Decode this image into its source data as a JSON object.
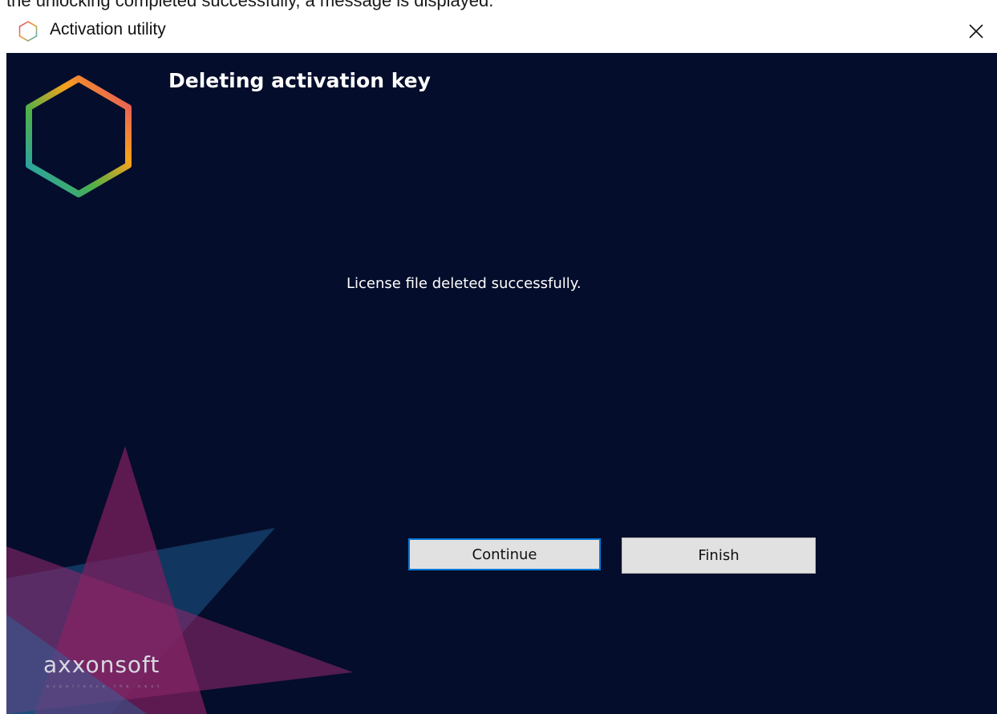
{
  "top_caption": "the unlocking completed successfully, a message is displayed.",
  "window": {
    "title": "Activation utility",
    "close_icon": "close-icon",
    "app_icon": "hexagon-logo-icon"
  },
  "dialog": {
    "heading": "Deleting activation key",
    "message": "License file deleted successfully.",
    "buttons": {
      "continue_label": "Continue",
      "finish_label": "Finish"
    }
  },
  "branding": {
    "name": "axxonsoft",
    "tagline": "experience the next"
  },
  "colors": {
    "background": "#040d2b",
    "button_focus_border": "#0a78d7",
    "button_face": "#e1e1e1"
  }
}
